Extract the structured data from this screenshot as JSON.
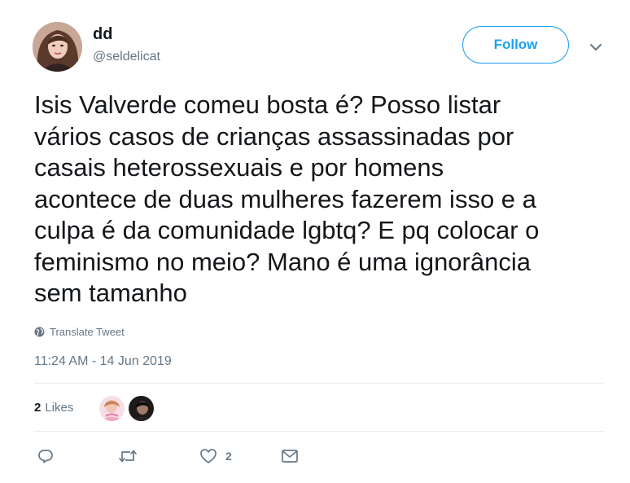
{
  "author": {
    "display_name": "dd",
    "handle": "@seldelicat",
    "avatar_icon": "user-avatar"
  },
  "follow_label": "Follow",
  "tweet": {
    "text": "Isis Valverde comeu bosta é? Posso listar\nvários casos de crianças assassinadas por\ncasais heterossexuais e por homens\nacontece de duas mulheres fazerem isso e a\nculpa é da comunidade lgbtq? E pq colocar o\nfeminismo no meio? Mano é uma ignorância\nsem tamanho",
    "translate_label": "Translate Tweet",
    "timestamp": "11:24 AM - 14 Jun 2019"
  },
  "likes": {
    "count": "2",
    "label": "Likes"
  },
  "actions": {
    "reply_icon": "reply-icon",
    "retweet_icon": "retweet-icon",
    "like_icon": "heart-icon",
    "like_count": "2",
    "dm_icon": "envelope-icon"
  },
  "colors": {
    "accent": "#1da1f2",
    "secondary_text": "#657786",
    "primary_text": "#14171a",
    "divider": "#e6ecf0"
  }
}
